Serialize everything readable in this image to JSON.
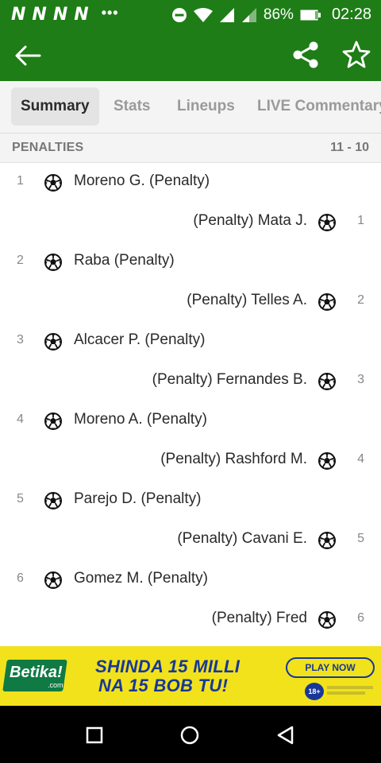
{
  "status_bar": {
    "app_icons": [
      "N",
      "N",
      "N",
      "N"
    ],
    "dots": "•••",
    "battery": "86%",
    "time": "02:28"
  },
  "tabs": [
    {
      "label": "Summary",
      "active": true
    },
    {
      "label": "Stats",
      "active": false
    },
    {
      "label": "Lineups",
      "active": false
    },
    {
      "label": "LIVE Commentary",
      "active": false
    }
  ],
  "penalties": {
    "title": "PENALTIES",
    "score": "11 - 10",
    "kicks": [
      {
        "side": "home",
        "number": "1",
        "player": "Moreno G. (Penalty)"
      },
      {
        "side": "away",
        "number": "1",
        "player": "(Penalty) Mata J."
      },
      {
        "side": "home",
        "number": "2",
        "player": "Raba (Penalty)"
      },
      {
        "side": "away",
        "number": "2",
        "player": "(Penalty) Telles A."
      },
      {
        "side": "home",
        "number": "3",
        "player": "Alcacer P. (Penalty)"
      },
      {
        "side": "away",
        "number": "3",
        "player": "(Penalty) Fernandes B."
      },
      {
        "side": "home",
        "number": "4",
        "player": "Moreno A. (Penalty)"
      },
      {
        "side": "away",
        "number": "4",
        "player": "(Penalty) Rashford M."
      },
      {
        "side": "home",
        "number": "5",
        "player": "Parejo D. (Penalty)"
      },
      {
        "side": "away",
        "number": "5",
        "player": "(Penalty) Cavani E."
      },
      {
        "side": "home",
        "number": "6",
        "player": "Gomez M. (Penalty)"
      },
      {
        "side": "away",
        "number": "6",
        "player": "(Penalty) Fred"
      }
    ]
  },
  "ad": {
    "logo": "Betika!",
    "logo_suffix": ".com",
    "tagline_1": "SHINDA 15 MILLI",
    "tagline_2": "NA 15 BOB TU!",
    "cta": "PLAY NOW",
    "age": "18+"
  },
  "colors": {
    "app_green": "#1e7d16",
    "ad_yellow": "#f2e21c",
    "ad_blue": "#17389a"
  },
  "icons": {
    "back": "arrow-left-icon",
    "share": "share-icon",
    "favorite": "star-outline-icon",
    "goal": "football-icon"
  }
}
